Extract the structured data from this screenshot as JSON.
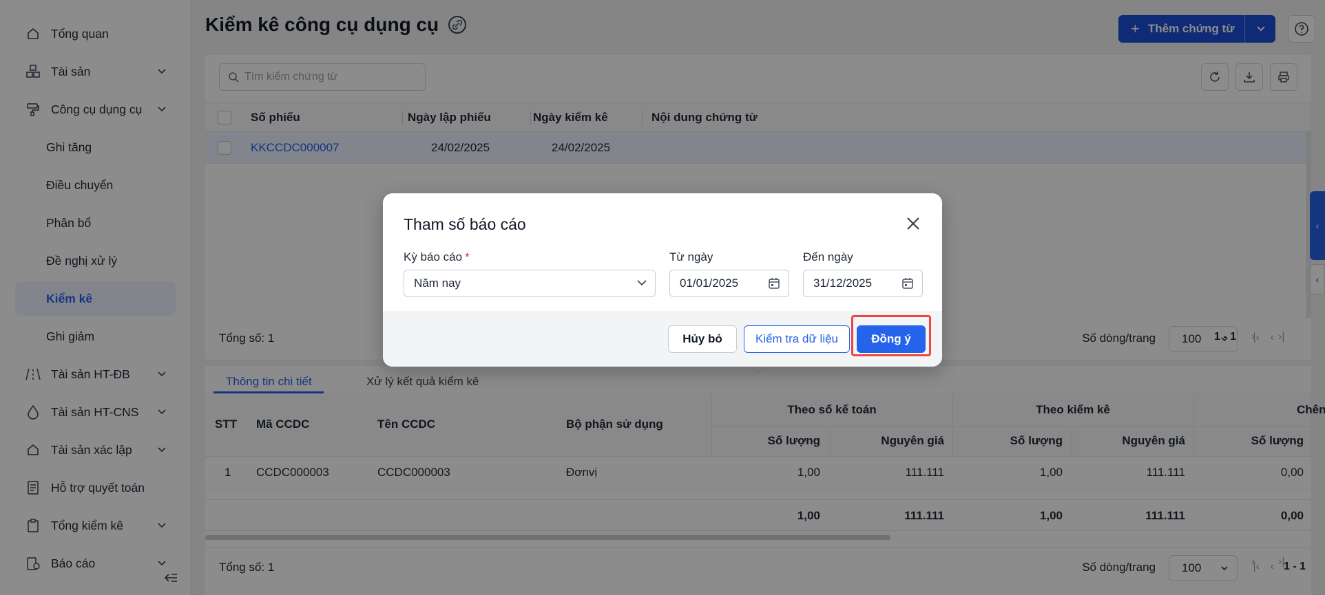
{
  "sidebar": {
    "items": [
      {
        "label": "Tổng quan",
        "icon": "home-icon",
        "has_chevron": false
      },
      {
        "label": "Tài sản",
        "icon": "cubes-icon",
        "has_chevron": true
      },
      {
        "label": "Công cụ dụng cụ",
        "icon": "paint-roller-icon",
        "has_chevron": true
      },
      {
        "label": "Tài sản HT-ĐB",
        "icon": "road-icon",
        "has_chevron": true
      },
      {
        "label": "Tài sản HT-CNS",
        "icon": "drop-icon",
        "has_chevron": true
      },
      {
        "label": "Tài sản xác lập",
        "icon": "home-icon",
        "has_chevron": true
      },
      {
        "label": "Hỗ trợ quyết toán",
        "icon": "doc-icon",
        "has_chevron": false
      },
      {
        "label": "Tổng kiểm kê",
        "icon": "clipboard-icon",
        "has_chevron": true
      },
      {
        "label": "Báo cáo",
        "icon": "report-icon",
        "has_chevron": true
      }
    ],
    "subitems": [
      "Ghi tăng",
      "Điều chuyển",
      "Phân bổ",
      "Đề nghị xử lý",
      "Kiểm kê",
      "Ghi giảm"
    ],
    "active_subitem": "Kiểm kê"
  },
  "header": {
    "title": "Kiểm kê công cụ dụng cụ",
    "add_button": "Thêm chứng từ"
  },
  "list": {
    "search_placeholder": "Tìm kiếm chứng từ",
    "columns": [
      "Số phiếu",
      "Ngày lập phiếu",
      "Ngày kiểm kê",
      "Nội dung chứng từ"
    ],
    "rows": [
      {
        "so_phieu": "KKCCDC000007",
        "ngay_lap": "24/02/2025",
        "ngay_kiem_ke": "24/02/2025",
        "noi_dung": ""
      }
    ],
    "footer": {
      "total": "Tổng số: 1",
      "per_page_label": "Số dòng/trang",
      "per_page": "100",
      "range": "1 - 1"
    }
  },
  "detail": {
    "tabs": [
      "Thông tin chi tiết",
      "Xử lý kết quả kiểm kê"
    ],
    "active_tab": "Thông tin chi tiết",
    "columns": {
      "stt": "STT",
      "ma": "Mã CCDC",
      "ten": "Tên CCDC",
      "bo_phan": "Bộ phận sử dụng",
      "group_so_ke_toan": "Theo sổ kế toán",
      "group_kiem_ke": "Theo kiểm kê",
      "group_chenh": "Chên",
      "so_luong": "Số lượng",
      "nguyen_gia": "Nguyên giá"
    },
    "rows": [
      {
        "stt": "1",
        "ma": "CCDC000003",
        "ten": "CCDC000003",
        "bo_phan": "Đơnvị",
        "sl_kt": "1,00",
        "ng_kt": "111.111",
        "sl_kk": "1,00",
        "ng_kk": "111.111",
        "sl_ch": "0,00"
      }
    ],
    "totals": {
      "sl_kt": "1,00",
      "ng_kt": "111.111",
      "sl_kk": "1,00",
      "ng_kk": "111.111",
      "sl_ch": "0,00"
    },
    "footer": {
      "total": "Tổng số: 1",
      "per_page_label": "Số dòng/trang",
      "per_page": "100",
      "range": "1 - 1"
    }
  },
  "modal": {
    "title": "Tham số báo cáo",
    "period_label": "Kỳ báo cáo",
    "period_required_mark": "*",
    "period_value": "Năm nay",
    "from_label": "Từ ngày",
    "from_value": "01/01/2025",
    "to_label": "Đến ngày",
    "to_value": "31/12/2025",
    "cancel": "Hủy bỏ",
    "check": "Kiểm tra dữ liệu",
    "ok": "Đồng ý"
  },
  "colors": {
    "accent": "#2563eb",
    "highlight": "#ef4444",
    "overlay": "rgba(0,0,0,0.45)"
  }
}
